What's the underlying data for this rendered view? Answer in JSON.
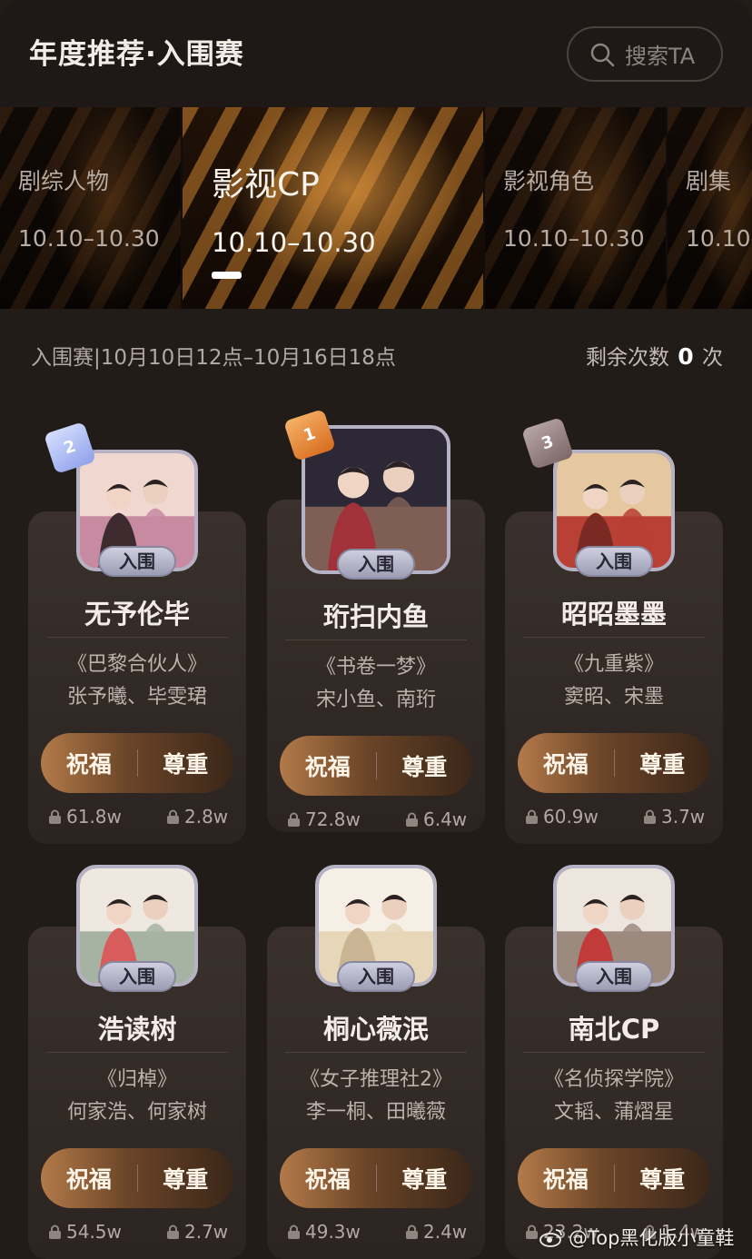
{
  "header": {
    "title": "年度推荐·入围赛",
    "search_label": "搜索TA"
  },
  "categories": [
    {
      "name": "剧综人物",
      "date": "10.10–10.30",
      "active": false
    },
    {
      "name": "影视CP",
      "date": "10.10–10.30",
      "active": true
    },
    {
      "name": "影视角色",
      "date": "10.10–10.30",
      "active": false
    },
    {
      "name": "剧集",
      "date": "10.10–",
      "active": false
    }
  ],
  "info": {
    "round": "入围赛|10月10日12点–10月16日18点",
    "remaining_prefix": "剩余次数",
    "remaining_count": "0",
    "remaining_suffix": "次"
  },
  "badge_label": "入围",
  "actions": {
    "bless": "祝福",
    "respect": "尊重"
  },
  "cards": [
    {
      "rank": "2",
      "name": "无予伦毕",
      "work": "《巴黎合伙人》",
      "cast": "张予曦、毕雯珺",
      "bless_count": "61.8w",
      "respect_count": "2.8w"
    },
    {
      "rank": "1",
      "name": "珩扫内鱼",
      "work": "《书卷一梦》",
      "cast": "宋小鱼、南珩",
      "bless_count": "72.8w",
      "respect_count": "6.4w"
    },
    {
      "rank": "3",
      "name": "昭昭墨墨",
      "work": "《九重紫》",
      "cast": "窦昭、宋墨",
      "bless_count": "60.9w",
      "respect_count": "3.7w"
    },
    {
      "rank": "",
      "name": "浩读树",
      "work": "《归棹》",
      "cast": "何家浩、何家树",
      "bless_count": "54.5w",
      "respect_count": "2.7w"
    },
    {
      "rank": "",
      "name": "桐心薇泯",
      "work": "《女子推理社2》",
      "cast": "李一桐、田曦薇",
      "bless_count": "49.3w",
      "respect_count": "2.4w"
    },
    {
      "rank": "",
      "name": "南北CP",
      "work": "《名侦探学院》",
      "cast": "文韬、蒲熠星",
      "bless_count": "23.2w",
      "respect_count": "1.4w"
    }
  ],
  "watermark": "@Top黑化版小童鞋",
  "colors": {
    "background": "#221c19",
    "accent": "#b37a49",
    "badge": "#b5b2c6"
  }
}
